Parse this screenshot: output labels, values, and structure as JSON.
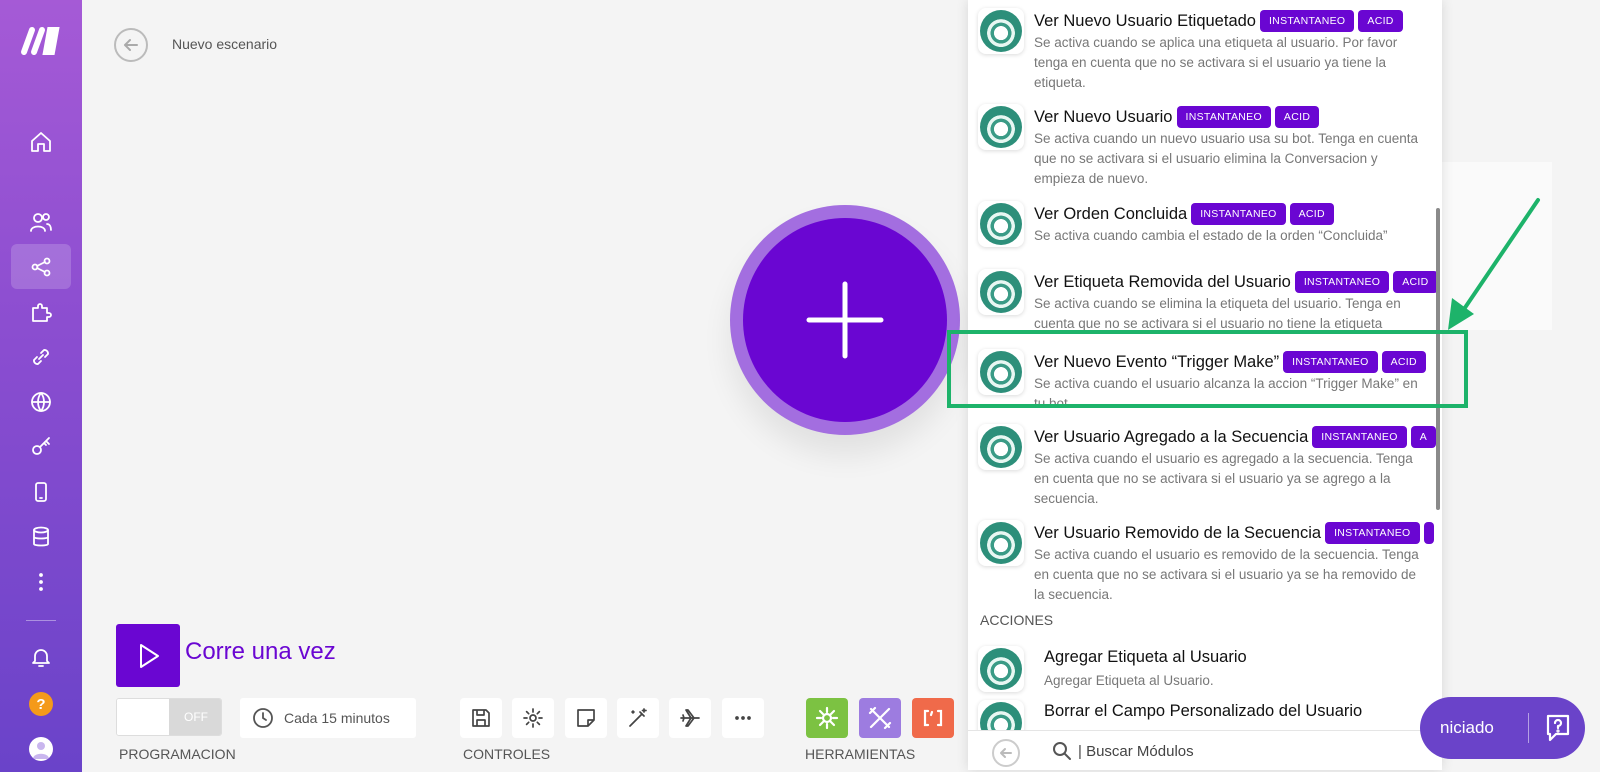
{
  "header": {
    "title": "Nuevo escenario"
  },
  "run": {
    "label": "Corre una vez"
  },
  "schedule": {
    "toggle_state": "OFF",
    "interval": "Cada 15 minutos"
  },
  "sections": {
    "programming": "PROGRAMACION",
    "controls": "CONTROLES",
    "tools": "HERRAMIENTAS"
  },
  "panel": {
    "triggers": [
      {
        "title": "Ver Nuevo Usuario Etiquetado",
        "badges": [
          "INSTANTANEO",
          "ACID"
        ],
        "desc": "Se activa cuando se aplica una etiqueta al usuario. Por favor tenga en cuenta que no se activara si el usuario ya tiene la etiqueta."
      },
      {
        "title": "Ver Nuevo Usuario",
        "badges": [
          "INSTANTANEO",
          "ACID"
        ],
        "desc": "Se activa cuando un nuevo usuario usa su bot. Tenga en cuenta que no se activara si el usuario elimina la Conversacion y empieza de nuevo."
      },
      {
        "title": "Ver Orden Concluida",
        "badges": [
          "INSTANTANEO",
          "ACID"
        ],
        "desc": "Se activa cuando cambia el estado de la orden “Concluida”"
      },
      {
        "title": "Ver Etiqueta Removida del Usuario",
        "badges": [
          "INSTANTANEO",
          "ACID"
        ],
        "desc": "Se activa cuando se elimina la etiqueta del usuario. Tenga en cuenta que no se activara si el usuario no tiene la etiqueta"
      },
      {
        "title": "Ver Nuevo Evento “Trigger Make”",
        "badges": [
          "INSTANTANEO",
          "ACID"
        ],
        "desc": "Se activa cuando el usuario alcanza la accion “Trigger Make” en tu bot."
      },
      {
        "title": "Ver Usuario Agregado a la Secuencia",
        "badges": [
          "INSTANTANEO",
          "A"
        ],
        "desc": "Se activa cuando el usuario es agregado a la secuencia. Tenga en cuenta que no se activara si el usuario ya se agrego a la secuencia."
      },
      {
        "title": "Ver Usuario Removido de la Secuencia",
        "badges": [
          "INSTANTANEO",
          ""
        ],
        "desc": "Se activa cuando el usuario es removido de la secuencia. Tenga en cuenta que no se activara si el usuario ya se ha removido de la secuencia."
      }
    ],
    "actions_label": "ACCIONES",
    "actions": [
      {
        "title": "Agregar Etiqueta al Usuario",
        "desc": "Agregar Etiqueta al Usuario."
      },
      {
        "title": "Borrar el Campo Personalizado del Usuario",
        "desc": ""
      }
    ],
    "search_placeholder": "| Buscar Módulos"
  },
  "get_started": {
    "label": "niciado"
  },
  "colors": {
    "accent": "#6a06d2",
    "highlight": "#1db36a",
    "sidebar_top": "#a55ad6",
    "sidebar_bottom": "#6a43c9"
  }
}
